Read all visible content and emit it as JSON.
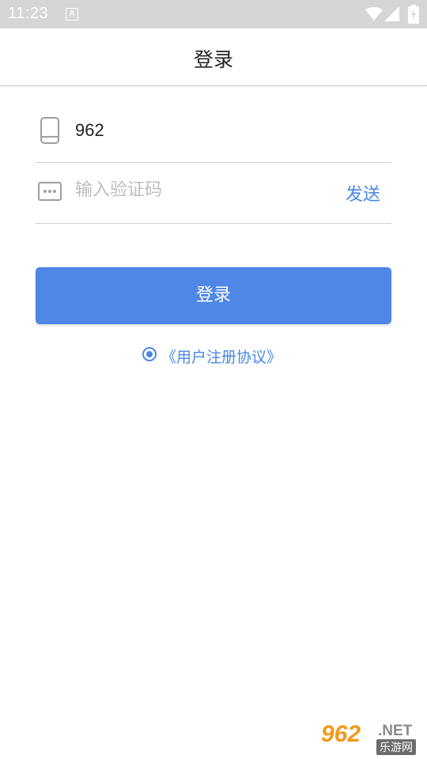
{
  "status_bar": {
    "time": "11:23",
    "notification_icon": "a-letter-icon",
    "wifi_icon": "wifi-icon",
    "signal_icon": "cell-signal-icon",
    "battery_icon": "battery-charging-icon"
  },
  "title_bar": {
    "title": "登录"
  },
  "form": {
    "phone": {
      "icon": "phone-icon",
      "value": "962"
    },
    "code": {
      "icon": "sms-icon",
      "placeholder": "输入验证码",
      "send_label": "发送"
    },
    "login_label": "登录"
  },
  "agreement": {
    "checked": true,
    "link_text": "《用户注册协议》"
  },
  "watermark": {
    "number": "962",
    "net": ".NET",
    "site": "乐游网"
  },
  "colors": {
    "accent": "#4a86e8",
    "button": "#4f87e6",
    "status_bar": "#d6d6d6",
    "divider": "#cfcfcf",
    "placeholder": "#bdbdbd"
  }
}
